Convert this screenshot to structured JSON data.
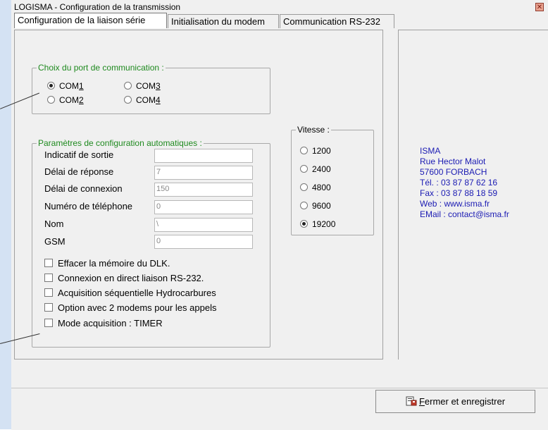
{
  "window": {
    "title": "LOGISMA - Configuration de la transmission",
    "close_glyph": "✕"
  },
  "tabs": [
    {
      "label": "Configuration de la liaison série"
    },
    {
      "label": "Initialisation du modem"
    },
    {
      "label": "Communication RS-232"
    }
  ],
  "com_group": {
    "legend": "Choix du port de communication :",
    "options": [
      {
        "label": "COM1",
        "accel": "1",
        "selected": true
      },
      {
        "label": "COM3",
        "accel": "3",
        "selected": false
      },
      {
        "label": "COM2",
        "accel": "2",
        "selected": false
      },
      {
        "label": "COM4",
        "accel": "4",
        "selected": false
      }
    ]
  },
  "params_group": {
    "legend": "Paramètres de configuration automatiques :",
    "fields": [
      {
        "label": "Indicatif de sortie",
        "value": ""
      },
      {
        "label": "Délai de réponse",
        "value": "7"
      },
      {
        "label": "Délai de connexion",
        "value": "150"
      },
      {
        "label": "Numéro de téléphone",
        "value": "0"
      },
      {
        "label": "Nom",
        "value": "\\"
      },
      {
        "label": "GSM",
        "value": "0"
      }
    ],
    "checkboxes": [
      {
        "label": "Effacer la mémoire du DLK.",
        "checked": false
      },
      {
        "label": "Connexion en direct liaison RS-232.",
        "checked": false
      },
      {
        "label": "Acquisition séquentielle Hydrocarbures",
        "checked": false
      },
      {
        "label": "Option avec 2 modems pour les appels",
        "checked": false
      },
      {
        "label": "Mode acquisition : TIMER",
        "checked": false
      }
    ]
  },
  "speed_group": {
    "legend": "Vitesse :",
    "options": [
      {
        "label": "1200",
        "selected": false
      },
      {
        "label": "2400",
        "selected": false
      },
      {
        "label": "4800",
        "selected": false
      },
      {
        "label": "9600",
        "selected": false
      },
      {
        "label": "19200",
        "selected": true
      }
    ]
  },
  "company_info": {
    "lines": [
      "ISMA",
      "Rue Hector Malot",
      "57600 FORBACH",
      "Tél. : 03 87 87 62 16",
      "Fax : 03 87 88 18 59",
      "Web : www.isma.fr",
      "EMail : contact@isma.fr"
    ],
    "color": "#1b1bb3"
  },
  "footer": {
    "save_button_label": "Fermer et enregistrer",
    "save_button_icon": "save-icon",
    "accel": "F"
  }
}
